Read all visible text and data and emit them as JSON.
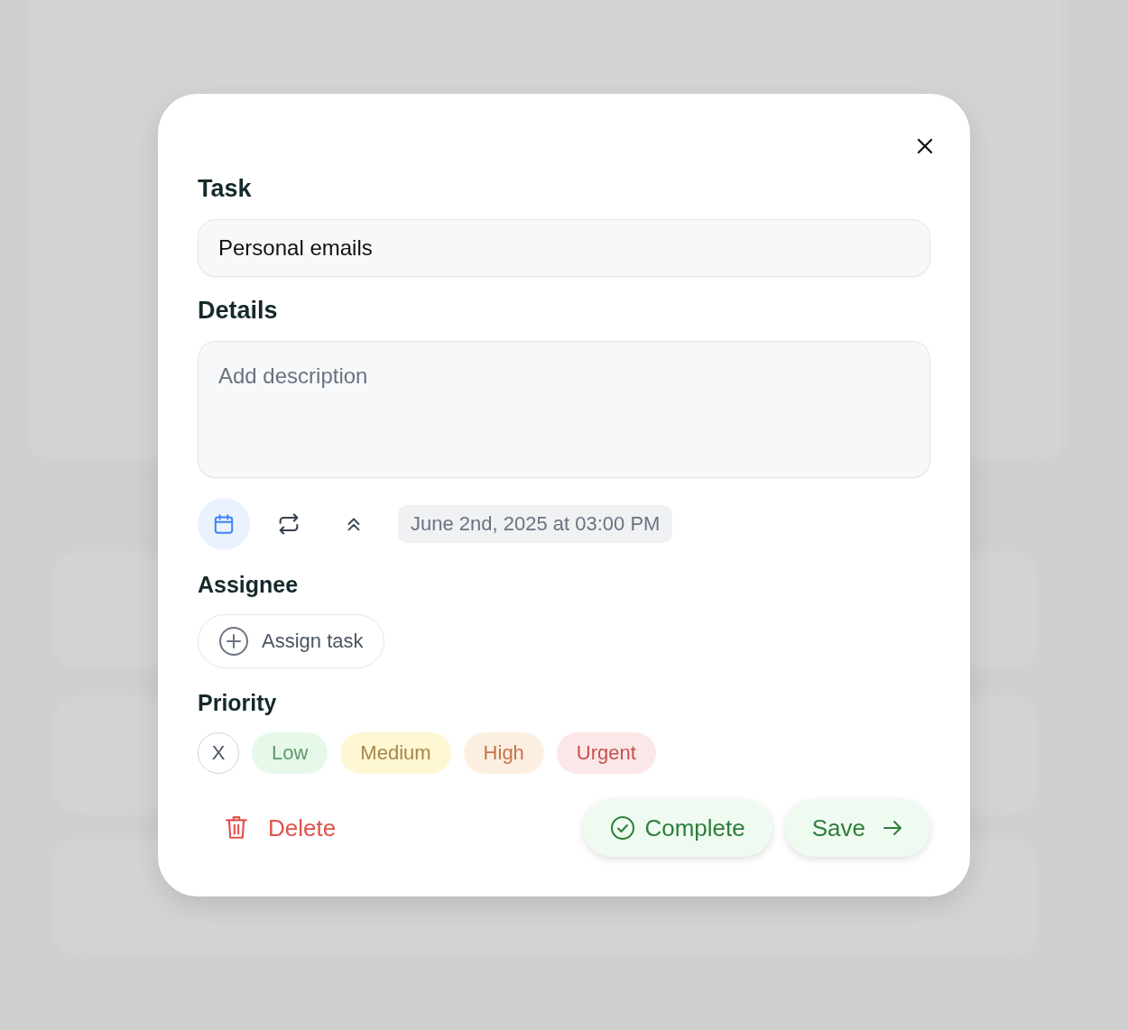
{
  "task": {
    "label": "Task",
    "value": "Personal emails"
  },
  "details": {
    "label": "Details",
    "placeholder": "Add description"
  },
  "tools": [
    {
      "kind": "calendar",
      "selected": true
    },
    {
      "kind": "repeat",
      "selected": false
    },
    {
      "kind": "priority",
      "selected": false
    }
  ],
  "due_date": "June 2nd, 2025 at 03:00 PM",
  "assignee": {
    "label": "Assignee",
    "button": "Assign task"
  },
  "priority": {
    "label": "Priority",
    "clear": "X",
    "options": [
      {
        "label": "Low",
        "color": "#5f9a68"
      },
      {
        "label": "Medium",
        "color": "#a8854a"
      },
      {
        "label": "High",
        "color": "#c7724a"
      },
      {
        "label": "Urgent",
        "color": "#c4524f"
      }
    ]
  },
  "actions": {
    "delete": "Delete",
    "complete": "Complete",
    "save": "Save"
  }
}
